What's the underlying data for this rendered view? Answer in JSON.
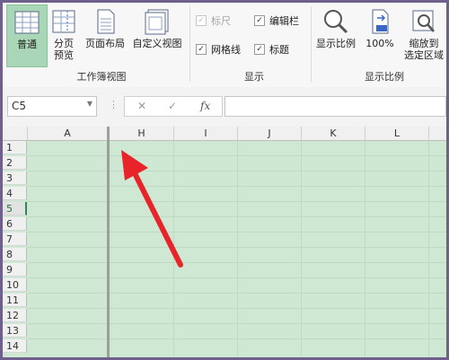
{
  "ribbon": {
    "views": [
      {
        "label": "普通",
        "active": true
      },
      {
        "label": "分页\n预览",
        "active": false
      },
      {
        "label": "页面布局",
        "active": false
      },
      {
        "label": "自定义视图",
        "active": false
      }
    ],
    "views_group": "工作簿视图",
    "show": {
      "ruler": "标尺",
      "formula_bar": "编辑栏",
      "gridlines": "网格线",
      "headings": "标题",
      "group": "显示"
    },
    "zoom": {
      "zoom_label": "显示比例",
      "zoom100_label": "100%",
      "zoom_selection_label": "缩放到\n选定区域",
      "group": "显示比例"
    }
  },
  "formula": {
    "name_box": "C5",
    "cancel": "✕",
    "enter": "✓",
    "fx": "fx",
    "value": ""
  },
  "grid": {
    "columns": [
      "A",
      "H",
      "I",
      "J",
      "K",
      "L"
    ],
    "rows": [
      "1",
      "2",
      "3",
      "4",
      "5",
      "6",
      "7",
      "8",
      "9",
      "10",
      "11",
      "12",
      "13",
      "14"
    ],
    "selected_row": "5"
  },
  "colors": {
    "cell_fill": "#cfe8d3",
    "active_view": "#a9d6b6",
    "arrow": "#e8232a"
  }
}
